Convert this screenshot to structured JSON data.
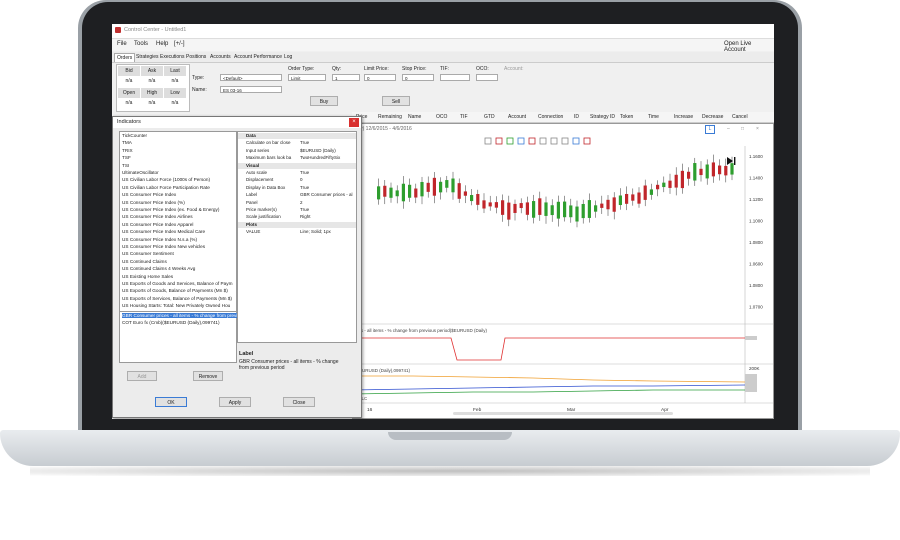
{
  "window": {
    "title": "Control Center - Untitled1",
    "open_live": "Open Live Account"
  },
  "menu": [
    "File",
    "Tools",
    "Help",
    "[+/-]"
  ],
  "tabs": [
    "Orders",
    "Strategies",
    "Executions",
    "Positions",
    "Accounts",
    "Account Performance",
    "Log"
  ],
  "quote": {
    "headers1": [
      "Bid",
      "Ask",
      "Last"
    ],
    "values1": [
      "n/a",
      "n/a",
      "n/a"
    ],
    "headers2": [
      "Open",
      "High",
      "Low"
    ],
    "values2": [
      "n/a",
      "n/a",
      "n/a"
    ]
  },
  "order_form": {
    "type_label": "Type:",
    "type_value": "<Default>",
    "name_label": "Name:",
    "name_value": "ES 03-16",
    "order_type_label": "Order Type:",
    "order_type_value": "Limit",
    "qty_label": "Qty:",
    "qty_value": "1",
    "limit_label": "Limit Price:",
    "limit_value": "0",
    "stop_label": "Stop Price:",
    "stop_value": "0",
    "tif_label": "TIF:",
    "oco_label": "OCO:",
    "account_label": "Account:",
    "buy": "Buy",
    "sell": "Sell"
  },
  "order_columns": [
    "Price",
    "Remaining",
    "Name",
    "OCO",
    "TIF",
    "GTD",
    "Account",
    "Connection",
    "ID",
    "Strategy ID",
    "Token",
    "Time",
    "Increase",
    "Decrease",
    "Cancel"
  ],
  "chart": {
    "title_text": "ly) 12/6/2015 - 4/6/2016",
    "x_ticks": [
      "16",
      "Feb",
      "Mar",
      "Apr"
    ],
    "price_ticks": [
      "1.1600",
      "1.1400",
      "1.1200",
      "1.1000",
      "1.0800",
      "1.0600",
      "1.0800",
      "1.0700"
    ],
    "panel2_label": "ices - all items - % change from previous period($EURUSD (Daily)",
    "panel3_label": "($EURUSD (Daily),099741)",
    "panel3_tick": "200K",
    "panel3_bottom_label": "LLC"
  },
  "dialog": {
    "title": "Indicators",
    "close": "×",
    "indicators": [
      "TickCounter",
      "TMA",
      "TRIX",
      "TSF",
      "TSI",
      "UltimateOscillator",
      "US Civilian Labor Force (1000s of Person)",
      "US Civilian Labor Force Participation Rate",
      "US Consumer Price Index",
      "US Consumer Price Index (%)",
      "US Consumer Price Index (ex. Food & Energy)",
      "US Consumer Price Index Airlines",
      "US Consumer Price Index Apparel",
      "US Consumer Price Index Medical Care",
      "US Consumer Price Index N.s.a (%)",
      "US Consumer Price Index New vehicles",
      "US Consumer Sentiment",
      "US Continued Claims",
      "US Continued Claims 4 Weeks Avg",
      "US Existing Home Sales",
      "US Exports of Goods and Services, Balance of Paym",
      "US Exports of Goods, Balance of Payments (Mn $)",
      "US Exports of Services, Balance of Payments (Mn $)",
      "US Housing Starts: Total: New Privately Owned Hou"
    ],
    "current": [
      "GBR Consumer prices - all items - % change from previo",
      "COT Euro fx (Cmb)($EURUSD (Daily),099741)"
    ],
    "remove": "Remove",
    "add": "Add",
    "props": [
      {
        "k": "Data",
        "v": "",
        "cat": true
      },
      {
        "k": "Calculate on bar close",
        "v": "True"
      },
      {
        "k": "Input series",
        "v": "$EURUSD (Daily)"
      },
      {
        "k": "Maximum bars look ba",
        "v": "TwoHundredFiftySix"
      },
      {
        "k": "Visual",
        "v": "",
        "cat": true
      },
      {
        "k": "Auto scale",
        "v": "True"
      },
      {
        "k": "Displacement",
        "v": "0"
      },
      {
        "k": "Display in Data Box",
        "v": "True"
      },
      {
        "k": "Label",
        "v": "GBR Consumer prices - al"
      },
      {
        "k": "Panel",
        "v": "2"
      },
      {
        "k": "Price marker(s)",
        "v": "True"
      },
      {
        "k": "Scale justification",
        "v": "Right"
      },
      {
        "k": "Plots",
        "v": "",
        "cat": true
      },
      {
        "k": "VALUE",
        "v": "Line; Solid; 1px"
      }
    ],
    "label_title": "Label",
    "label_desc": "GBR Consumer prices - all items - % change from previous period",
    "ok": "OK",
    "apply": "Apply",
    "close_btn": "Close"
  },
  "colors": {
    "up": "#2e9e2e",
    "down": "#c0262b",
    "line_red": "#e03030",
    "line_orange": "#f0a030",
    "line_blue": "#3050d0",
    "line_green": "#30a040"
  }
}
